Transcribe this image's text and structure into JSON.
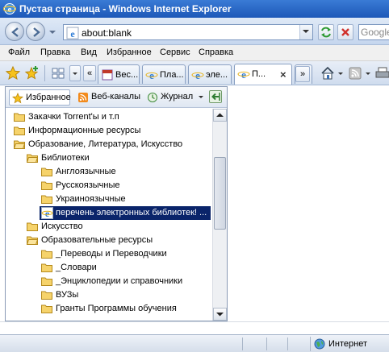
{
  "window": {
    "title": "Пустая страница - Windows Internet Explorer"
  },
  "address": {
    "url": "about:blank",
    "search_placeholder": "Google"
  },
  "menu": [
    "Файл",
    "Правка",
    "Вид",
    "Избранное",
    "Сервис",
    "Справка"
  ],
  "tabs": [
    {
      "label": "Вес...",
      "icon": "sheet-icon"
    },
    {
      "label": "Пла...",
      "icon": "ie-icon"
    },
    {
      "label": "эле...",
      "icon": "ie-icon"
    },
    {
      "label": "П...",
      "icon": "ie-icon",
      "active": true
    }
  ],
  "toolbar": {
    "chevron_left": "«",
    "chevron_right": "»",
    "close_tab": "×"
  },
  "favorites_panel": {
    "tabs": [
      "Избранное",
      "Веб-каналы",
      "Журнал"
    ],
    "items": [
      {
        "label": "Закачки Torrent'ы и т.п",
        "type": "folder",
        "level": 0
      },
      {
        "label": "Информационные ресурсы",
        "type": "folder",
        "level": 0
      },
      {
        "label": "Образование, Литература, Искусство",
        "type": "folder-open",
        "level": 0
      },
      {
        "label": "Библиотеки",
        "type": "folder-open",
        "level": 1
      },
      {
        "label": "Англоязычные",
        "type": "folder",
        "level": 2
      },
      {
        "label": "Русскоязычные",
        "type": "folder",
        "level": 2
      },
      {
        "label": "Украиноязычные",
        "type": "folder",
        "level": 2
      },
      {
        "label": "перечень электронных библиотек! ...",
        "type": "link",
        "level": 2,
        "selected": true
      },
      {
        "label": "Искусство",
        "type": "folder",
        "level": 1
      },
      {
        "label": "Образовательные ресурсы",
        "type": "folder-open",
        "level": 1
      },
      {
        "label": "_Переводы и Переводчики",
        "type": "folder",
        "level": 2
      },
      {
        "label": "_Словари",
        "type": "folder",
        "level": 2
      },
      {
        "label": "_Энциклопедии и справочники",
        "type": "folder",
        "level": 2
      },
      {
        "label": "ВУЗы",
        "type": "folder",
        "level": 2
      },
      {
        "label": "Гранты Программы обучения",
        "type": "folder",
        "level": 2
      }
    ]
  },
  "status": {
    "zone": "Интернет"
  },
  "colors": {
    "selection": "#0a246a",
    "titlebar": "#1d58b8",
    "folder": "#f6d36b"
  }
}
